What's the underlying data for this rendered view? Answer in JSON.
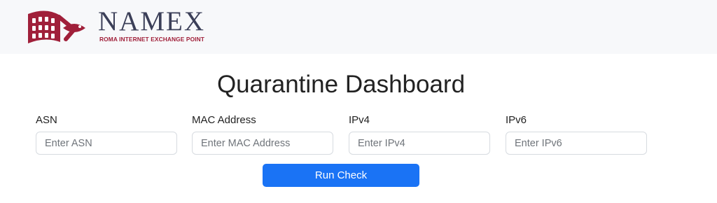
{
  "header": {
    "brand_name": "NAMEX",
    "brand_tagline": "ROMA INTERNET EXCHANGE POINT",
    "logo_icon": "namex-colosseum-fish-logo-icon",
    "brand_color": "#a0203a",
    "text_color": "#3b3f58"
  },
  "main": {
    "title": "Quarantine Dashboard",
    "fields": [
      {
        "label": "ASN",
        "placeholder": "Enter ASN",
        "value": ""
      },
      {
        "label": "MAC Address",
        "placeholder": "Enter MAC Address",
        "value": ""
      },
      {
        "label": "IPv4",
        "placeholder": "Enter IPv4",
        "value": ""
      },
      {
        "label": "IPv6",
        "placeholder": "Enter IPv6",
        "value": ""
      }
    ],
    "submit_label": "Run Check",
    "accent_color": "#1a73f5"
  }
}
